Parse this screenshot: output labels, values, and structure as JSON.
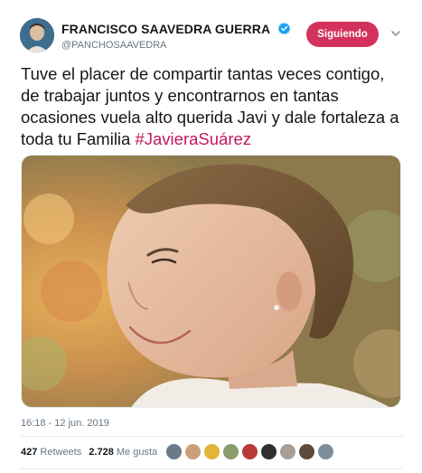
{
  "author": {
    "name": "FRANCISCO SAAVEDRA GUERRA",
    "handle": "@PANCHOSAAVEDRA",
    "verified_icon": "verified-badge-icon"
  },
  "follow_button": {
    "label": "Siguiendo",
    "color": "#d3325c"
  },
  "tweet": {
    "text": "Tuve el placer de compartir tantas veces contigo, de trabajar juntos y encontrarnos en tantas ocasiones vuela alto querida Javi y dale fortaleza a toda tu Familia ",
    "hashtag": "#JavieraSuárez",
    "hashtag_color": "#c2185b",
    "timestamp": "16:18 - 12 jun. 2019"
  },
  "stats": {
    "retweets_count": "427",
    "retweets_label": "Retweets",
    "likes_count": "2.728",
    "likes_label": "Me gusta"
  },
  "likers": [
    {
      "color": "#6b7a86"
    },
    {
      "color": "#c9a07a"
    },
    {
      "color": "#e2b43a"
    },
    {
      "color": "#8a9b6e"
    },
    {
      "color": "#b83a3a"
    },
    {
      "color": "#2f2f2f"
    },
    {
      "color": "#a89f94"
    },
    {
      "color": "#5c4a3f"
    },
    {
      "color": "#7d8d99"
    }
  ]
}
